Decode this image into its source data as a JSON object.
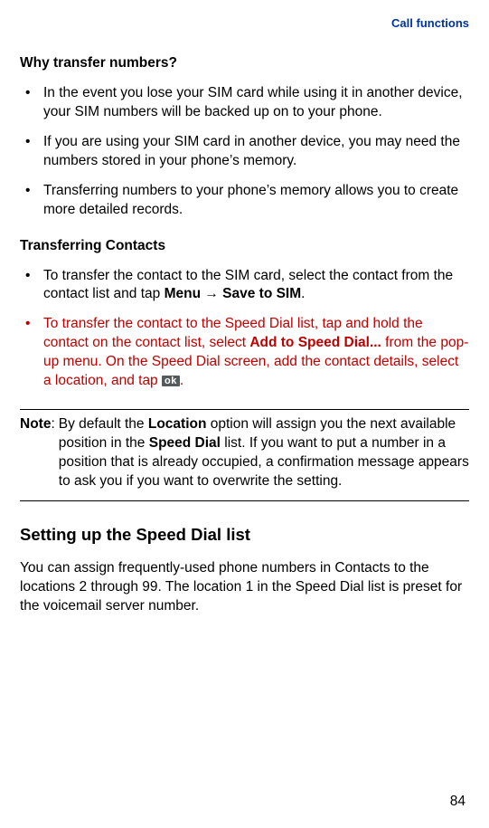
{
  "header": {
    "section_link": "Call functions"
  },
  "s1": {
    "heading": "Why transfer numbers?",
    "bullets": [
      "In the event you lose your SIM card while using it in another device, your SIM numbers will be backed up on to your phone.",
      "If you are using your SIM card in another device, you may need the numbers stored in your phone’s memory.",
      "Transferring numbers to your phone’s memory allows you to create more detailed records."
    ]
  },
  "s2": {
    "heading": "Transferring Contacts",
    "b1_pre": "To transfer the contact to the SIM card, select the contact from the contact list and tap ",
    "b1_bold1": "Menu",
    "b1_mid": " → ",
    "b1_bold2": "Save to SIM",
    "b1_post": ".",
    "b2_pre": "To transfer the contact to the Speed Dial list, tap and hold the contact on the contact list, select ",
    "b2_bold": "Add to Speed Dial...",
    "b2_mid": " from the pop-up menu. On the Speed Dial screen, add the contact details, select a location, and tap ",
    "b2_ok": "ok",
    "b2_post": "."
  },
  "note": {
    "label": "Note",
    "colon": ": ",
    "pre": "By default the ",
    "bold1": "Location",
    "mid1": " option will assign you the next available position in the ",
    "bold2": "Speed Dial",
    "post": " list. If you want to put a number in a position that is already occupied, a confirmation message appears to ask you if you want to overwrite the setting."
  },
  "s3": {
    "heading": "Setting up the Speed Dial list",
    "para": "You can assign frequently-used phone numbers in Contacts to the locations 2 through 99. The location 1 in the Speed Dial list is preset for the voicemail server number."
  },
  "page_number": "84"
}
